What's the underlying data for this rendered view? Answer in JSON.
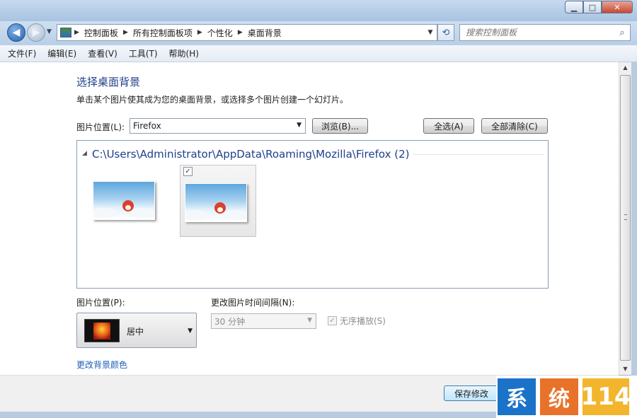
{
  "window": {
    "min_glyph": "▁",
    "max_glyph": "□",
    "close_glyph": "✕"
  },
  "nav": {
    "back_glyph": "◀",
    "forward_glyph": "▶",
    "recent_glyph": "▼"
  },
  "address": {
    "breadcrumbs": [
      "控制面板",
      "所有控制面板项",
      "个性化",
      "桌面背景"
    ],
    "separator": "▶",
    "dropdown_glyph": "▼",
    "refresh_glyph": "⟲"
  },
  "search": {
    "placeholder": "搜索控制面板",
    "icon_glyph": "⌕"
  },
  "menu": {
    "items": [
      "文件(F)",
      "编辑(E)",
      "查看(V)",
      "工具(T)",
      "帮助(H)"
    ]
  },
  "page": {
    "heading": "选择桌面背景",
    "subtitle": "单击某个图片使其成为您的桌面背景，或选择多个图片创建一个幻灯片。",
    "location_label": "图片位置(L):",
    "location_value": "Firefox",
    "browse_button": "浏览(B)...",
    "select_all_button": "全选(A)",
    "clear_all_button": "全部清除(C)"
  },
  "gallery": {
    "group_arrow": "◢",
    "group_title": "C:\\Users\\Administrator\\AppData\\Roaming\\Mozilla\\Firefox (2)",
    "images": [
      {
        "name": "image-1",
        "checked": false
      },
      {
        "name": "image-2",
        "checked": true
      }
    ],
    "check_glyph": "✓"
  },
  "position": {
    "label": "图片位置(P):",
    "value": "居中",
    "arrow": "▼"
  },
  "interval": {
    "label": "更改图片时间间隔(N):",
    "value": "30 分钟",
    "arrow": "▼"
  },
  "shuffle": {
    "label": "无序播放(S)",
    "checked": true,
    "check_glyph": "✓"
  },
  "change_color_link": "更改背景颜色",
  "save_button": "保存修改",
  "scrollbar": {
    "up": "▲",
    "down": "▼"
  },
  "watermark": {
    "char1": "系",
    "char2": "统",
    "number": "114"
  }
}
